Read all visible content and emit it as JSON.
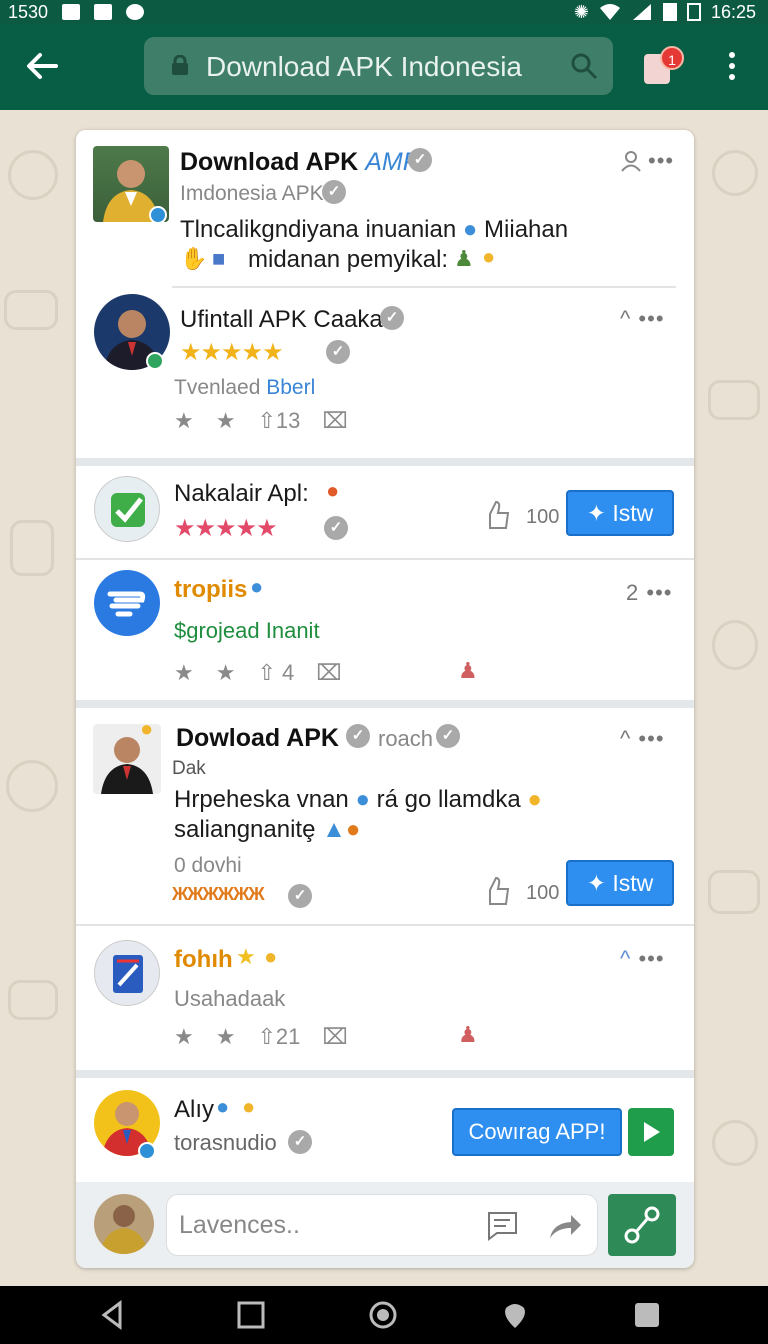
{
  "status_bar": {
    "time_left": "1530",
    "time_right": "16:25"
  },
  "app_bar": {
    "back_icon": "arrow-left-icon",
    "url_text": "Download APK Indonesia",
    "notification_count": "1"
  },
  "posts": [
    {
      "title_main": "Download APK",
      "title_accent": "AMP",
      "subtitle": "Imdonesia APK",
      "body_line1": "Tlncalikgndiyana inuanian",
      "body_line1_end": "Miiahan",
      "body_line2": "midanan pemyikal:",
      "nested": {
        "name": "Ufintall APK Caaka",
        "stars": "★★★★★",
        "meta": "Tvenlaed",
        "meta_accent": "Bberl",
        "share_count": "13"
      }
    },
    {
      "name": "Nakalair Apl:",
      "stars": "★★★★★",
      "like_count": "100",
      "button": "Istw"
    },
    {
      "name": "tropiis",
      "subtitle": "$grojead Inanit",
      "dots_label": "2",
      "share_count": "4"
    },
    {
      "title": "Dowload APK",
      "title_accent": "roach",
      "subtitle": "Dak",
      "body_line1": "Hrpeheska vnan",
      "body_line1_end": "rá go llamdka",
      "body_line2": "saliangnanitȩ",
      "meta": "0 dovhi",
      "tags": "ЖЖЖЖЖЖ",
      "like_count": "100",
      "button": "Istw"
    },
    {
      "name": "fohıh",
      "subtitle": "Usahadaak",
      "share_count": "21"
    },
    {
      "name": "Alıy",
      "subtitle": "torasnudio",
      "button": "Cowırag APP!"
    }
  ],
  "composer": {
    "placeholder": "Lavences.."
  },
  "colors": {
    "header": "#075e44",
    "accent_blue": "#2f8ff0",
    "accent_green": "#1f9d4a",
    "orange_name": "#e08a00"
  }
}
